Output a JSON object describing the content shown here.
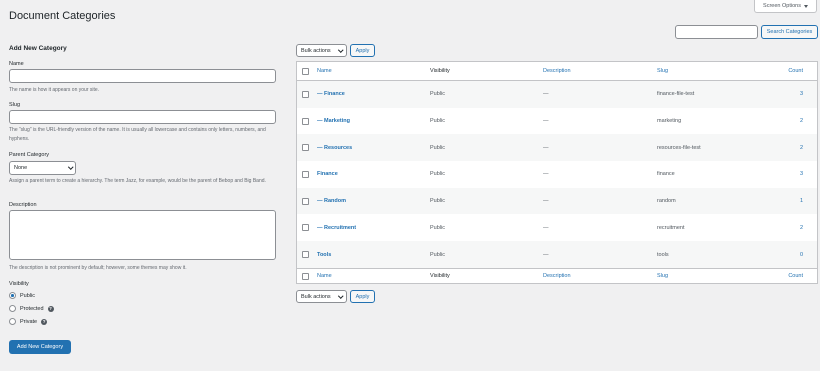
{
  "screen_options": "Screen Options",
  "page_title": "Document Categories",
  "search": {
    "placeholder": "",
    "button": "Search Categories"
  },
  "form": {
    "title": "Add New Category",
    "name_label": "Name",
    "name_hint": "The name is how it appears on your site.",
    "slug_label": "Slug",
    "slug_hint": "The “slug” is the URL-friendly version of the name. It is usually all lowercase and contains only letters, numbers, and hyphens.",
    "parent_label": "Parent Category",
    "parent_value": "None",
    "parent_hint": "Assign a parent term to create a hierarchy. The term Jazz, for example, would be the parent of Bebop and Big Band.",
    "description_label": "Description",
    "description_hint": "The description is not prominent by default; however, some themes may show it.",
    "visibility_label": "Visibility",
    "visibility_options": [
      "Public",
      "Protected",
      "Private"
    ],
    "visibility_selected": "Public",
    "submit": "Add New Category"
  },
  "bulk": {
    "label": "Bulk actions",
    "apply": "Apply"
  },
  "table": {
    "columns": {
      "name": "Name",
      "visibility": "Visibility",
      "description": "Description",
      "slug": "Slug",
      "count": "Count"
    },
    "rows": [
      {
        "name": "— Finance",
        "visibility": "Public",
        "description": "—",
        "slug": "finance-file-test",
        "count": "3"
      },
      {
        "name": "— Marketing",
        "visibility": "Public",
        "description": "—",
        "slug": "marketing",
        "count": "2"
      },
      {
        "name": "— Resources",
        "visibility": "Public",
        "description": "—",
        "slug": "resources-file-test",
        "count": "2"
      },
      {
        "name": "Finance",
        "visibility": "Public",
        "description": "—",
        "slug": "finance",
        "count": "3"
      },
      {
        "name": "— Random",
        "visibility": "Public",
        "description": "—",
        "slug": "random",
        "count": "1"
      },
      {
        "name": "— Recruitment",
        "visibility": "Public",
        "description": "—",
        "slug": "recruitment",
        "count": "2"
      },
      {
        "name": "Tools",
        "visibility": "Public",
        "description": "—",
        "slug": "tools",
        "count": "0"
      }
    ]
  },
  "colors": {
    "accent": "#2271b1",
    "background": "#f0f0f1"
  }
}
